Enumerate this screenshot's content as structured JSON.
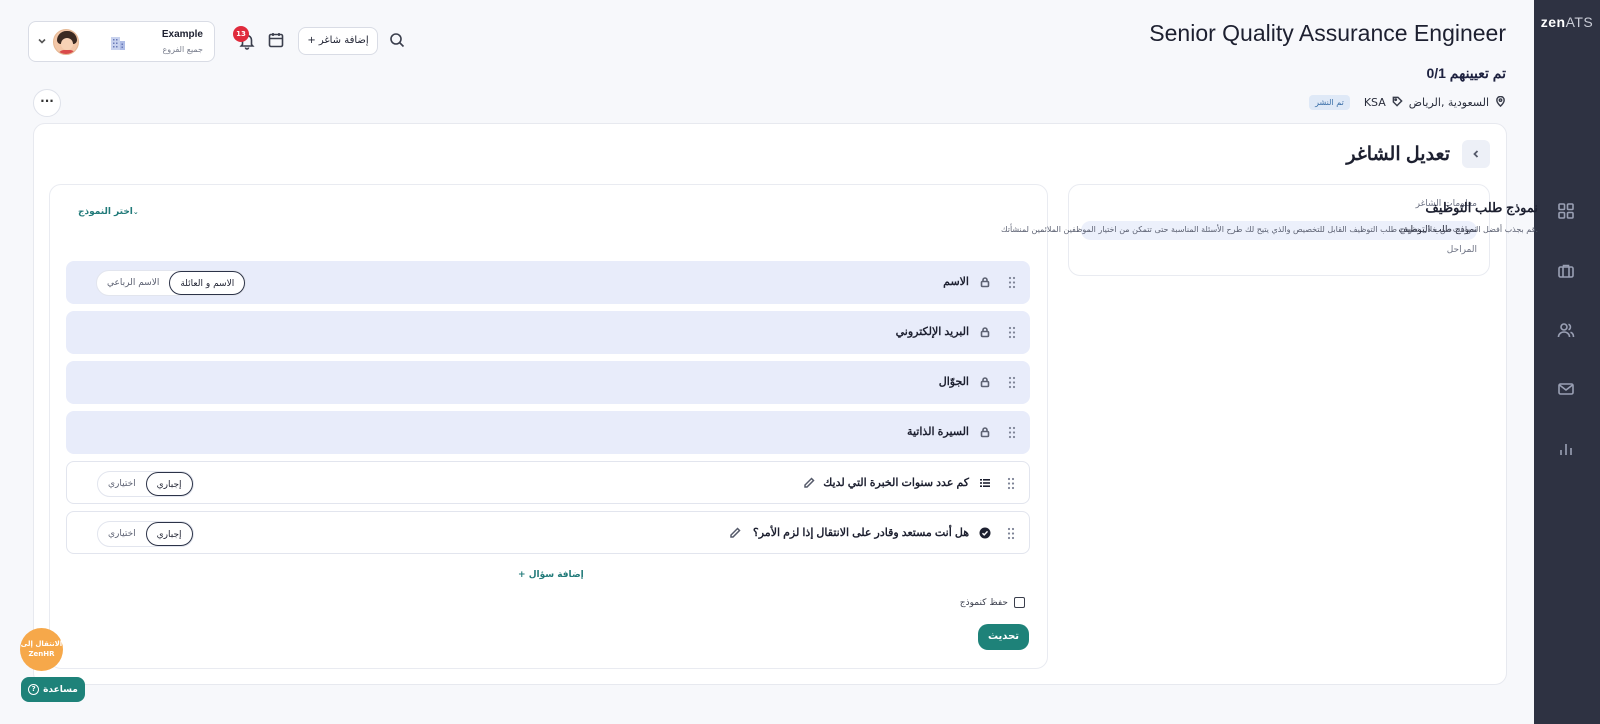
{
  "brand": {
    "logo_main": "zen",
    "logo_sub": "ATS"
  },
  "sidebar": {
    "icons": [
      "grid-icon",
      "briefcase-icon",
      "users-icon",
      "mail-icon",
      "bar-chart-icon"
    ]
  },
  "header": {
    "job_title": "Senior Quality Assurance Engineer",
    "assigned": "0/1 تم تعيينهم",
    "location": "السعودية ,الرياض",
    "tag": "KSA",
    "status_badge": "تم النشر",
    "add_talent_label": "+ إضافة شاغر",
    "notification_count": "13",
    "org_name": "Example",
    "org_branches": "جميع الفروع",
    "more_label": "···"
  },
  "page": {
    "title": "تعديل الشاغر"
  },
  "steps": [
    {
      "label": "معلومات الشاغر"
    },
    {
      "label": "نموذج طلب التوظيف"
    },
    {
      "label": "المراحل"
    }
  ],
  "form": {
    "title": "نموذج طلب التوظيف",
    "description": "قم بجذب أفضل المواهب من خلال نموذج طلب التوظيف القابل للتخصيص والذي يتيح لك طرح الأسئلة المناسبة حتى تتمكن من اختيار الموظفين الملائمين لمنشأتك.",
    "choose_template": "اختر النموذج",
    "fields": [
      {
        "label": "الاسم",
        "option_a": "الاسم و العائلة",
        "option_b": "الاسم الرباعي"
      },
      {
        "label": "البريد الإلكتروني"
      },
      {
        "label": "الجوّال"
      },
      {
        "label": "السيرة الذاتية"
      }
    ],
    "questions": [
      {
        "label": "كم عدد سنوات الخبرة التي لديك",
        "required": "إجباري",
        "optional": "اختياري"
      },
      {
        "label": "هل أنت مستعد وقادر على الانتقال إذا لزم الأمر؟",
        "required": "إجباري",
        "optional": "اختياري"
      }
    ],
    "add_question": "+ إضافة سؤال",
    "save_as_template": "حفظ كنموذج",
    "update_button": "تحديث"
  },
  "floating": {
    "zenhr_line1": "الانتقال إلى",
    "zenhr_line2": "ZenHR",
    "help_label": "مساعدة"
  },
  "colors": {
    "accent": "#1e8279",
    "sidebar_bg": "#2e3242",
    "locked_row_bg": "#e8ecfa",
    "notification": "#e02b3c"
  }
}
